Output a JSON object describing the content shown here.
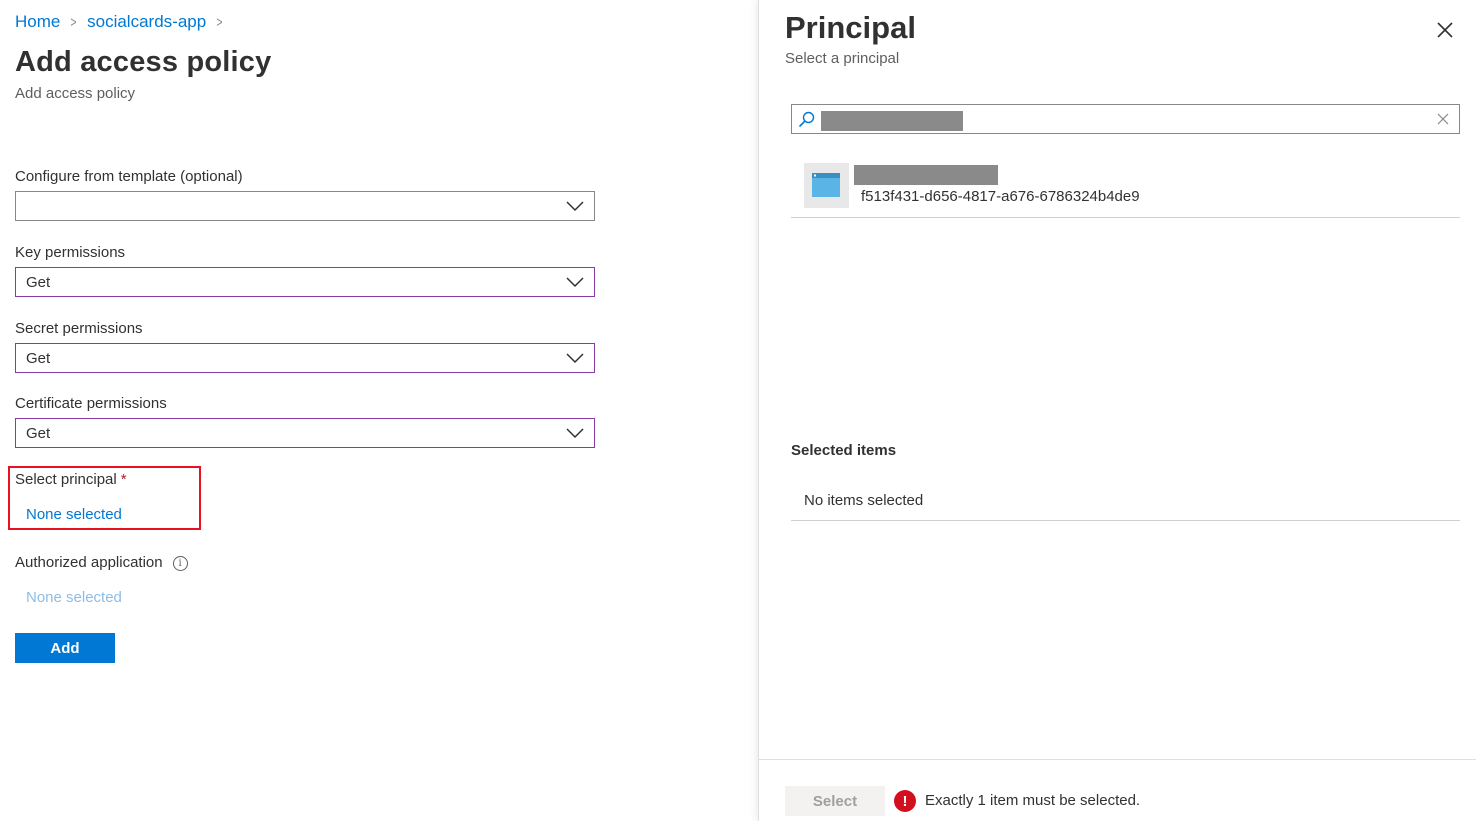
{
  "breadcrumb": {
    "home": "Home",
    "resource": "socialcards-app",
    "separator": ">"
  },
  "page": {
    "title": "Add access policy",
    "subtitle": "Add access policy"
  },
  "form": {
    "template": {
      "label": "Configure from template (optional)",
      "value": ""
    },
    "key_permissions": {
      "label": "Key permissions",
      "value": "Get"
    },
    "secret_permissions": {
      "label": "Secret permissions",
      "value": "Get"
    },
    "certificate_permissions": {
      "label": "Certificate permissions",
      "value": "Get"
    },
    "select_principal": {
      "label": "Select principal",
      "required_marker": "*",
      "value": "None selected"
    },
    "authorized_application": {
      "label": "Authorized application",
      "info_glyph": "i",
      "value": "None selected"
    },
    "add_button": "Add"
  },
  "panel": {
    "title": "Principal",
    "subtitle": "Select a principal",
    "search": {
      "value": "",
      "icon": "search-icon"
    },
    "results": [
      {
        "name": "",
        "id": "f513f431-d656-4817-a676-6786324b4de9",
        "icon": "app-icon"
      }
    ],
    "selected_heading": "Selected items",
    "selected_empty": "No items selected",
    "footer": {
      "select_button": "Select",
      "error_glyph": "!",
      "error_message": "Exactly 1 item must be selected."
    }
  },
  "colors": {
    "link": "#0078d4",
    "primary_button": "#0078d4",
    "focus_border": "#8a3aa6",
    "highlight_box": "#e81123",
    "error": "#d20f1f"
  }
}
